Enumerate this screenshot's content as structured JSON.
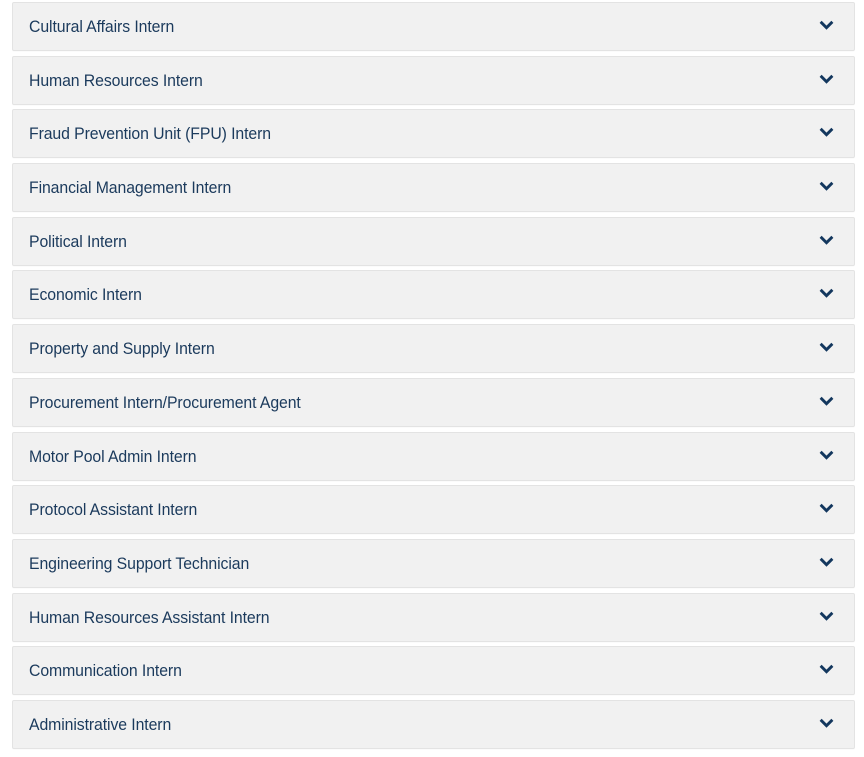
{
  "accordion": {
    "expand_icon": "chevron-down-icon",
    "colors": {
      "panel_background": "#f1f1f1",
      "panel_border": "#e3e3e3",
      "title_text": "#1b3a5c",
      "icon": "#13375e",
      "page_background": "#ffffff"
    },
    "items": [
      {
        "label": "Cultural Affairs Intern",
        "expanded": false
      },
      {
        "label": "Human Resources Intern",
        "expanded": false
      },
      {
        "label": "Fraud Prevention Unit (FPU) Intern",
        "expanded": false
      },
      {
        "label": "Financial Management Intern",
        "expanded": false
      },
      {
        "label": "Political Intern",
        "expanded": false
      },
      {
        "label": "Economic Intern",
        "expanded": false
      },
      {
        "label": "Property and Supply Intern",
        "expanded": false
      },
      {
        "label": "Procurement Intern/Procurement Agent",
        "expanded": false
      },
      {
        "label": "Motor Pool Admin Intern",
        "expanded": false
      },
      {
        "label": "Protocol Assistant Intern",
        "expanded": false
      },
      {
        "label": "Engineering Support Technician",
        "expanded": false
      },
      {
        "label": "Human Resources Assistant Intern",
        "expanded": false
      },
      {
        "label": "Communication Intern",
        "expanded": false
      },
      {
        "label": "Administrative Intern",
        "expanded": false
      }
    ]
  }
}
